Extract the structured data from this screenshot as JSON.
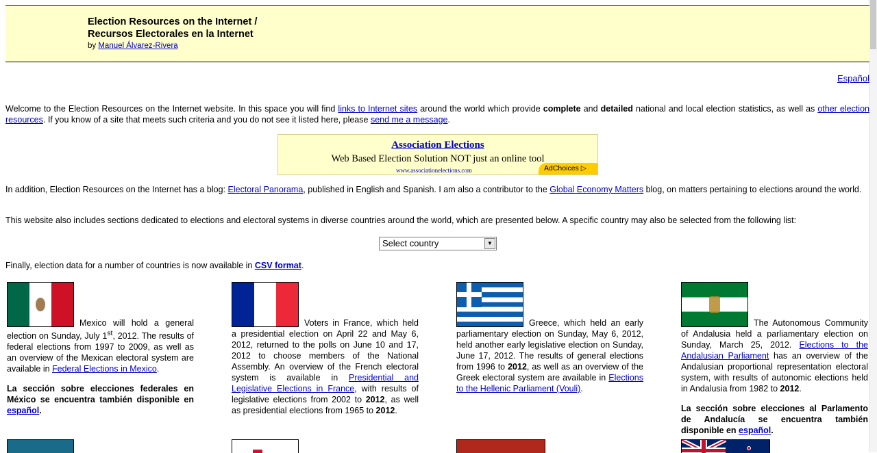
{
  "header": {
    "title_line1": "Election Resources on the Internet /",
    "title_line2": "Recursos Electorales en la Internet",
    "by_prefix": "by ",
    "author": "Manuel Álvarez-Rivera"
  },
  "language_link": "Español",
  "intro": {
    "t1": "Welcome to the Election Resources on the Internet website. In this space you will find ",
    "link1": "links to Internet sites",
    "t2": " around the world which provide ",
    "b1": "complete",
    "t3": " and ",
    "b2": "detailed",
    "t4": " national and local election statistics, as well as ",
    "link2": "other election resources",
    "t5": ". If you know of a site that meets such criteria and you do not see it listed here, please ",
    "link3": "send me a message",
    "t6": "."
  },
  "ad": {
    "title": "Association Elections",
    "text": "Web Based Election Solution NOT just an online tool",
    "url": "www.associationelections.com",
    "adchoices": "AdChoices"
  },
  "blog": {
    "t1": "In addition, Election Resources on the Internet has a blog: ",
    "link1": "Electoral Panorama",
    "t2": ", published in English and Spanish. I am also a contributor to the ",
    "link2": "Global Economy Matters",
    "t3": " blog, on matters pertaining to elections around the world."
  },
  "sections_text": "This website also includes sections dedicated to elections and electoral systems in diverse countries around the world, which are presented below. A specific country may also be selected from the following list:",
  "country_select": {
    "value": "Select country"
  },
  "csv": {
    "t1": "Finally, election data for a number of countries is now available in ",
    "link": "CSV format",
    "t2": "."
  },
  "mexico": {
    "t1": "Mexico will hold a general election on Sunday, July 1",
    "sup": "st",
    "t2": ", 2012. The results of federal elections from 1997 to 2009, as well as an overview of the Mexican electoral system are available in ",
    "link": "Federal Elections in Mexico",
    "t3": ".",
    "note": "La sección sobre elecciones federales en México se encuentra también disponible en ",
    "note_link": "español",
    "note_end": "."
  },
  "france": {
    "t1": "Voters in France, which held a presidential election on April 22 and May 6, 2012, returned to the polls on June 10 and 17, 2012 to choose members of the National Assembly. An overview of the French electoral system is available in ",
    "link": "Presidential and Legislative Elections in France",
    "t2": ", with results of legislative elections from 2002 to ",
    "b1": "2012",
    "t3": ", as well as presidential elections from 1965 to ",
    "b2": "2012",
    "t4": "."
  },
  "greece": {
    "t1": "Greece, which held an early parliamentary election on Sunday, May 6, 2012, held another early legislative election on Sunday, June 17, 2012. The results of general elections from 1996 to ",
    "b1": "2012",
    "t2": ", as well as an overview of the Greek electoral system are available in ",
    "link": "Elections to the Hellenic Parliament (Vouli)",
    "t3": "."
  },
  "andalusia": {
    "t1": "The Autonomous Community of Andalusia held a parliamentary election on Sunday, March 25, 2012. ",
    "link": "Elections to the Andalusian Parliament",
    "t2": " has an overview of the Andalusian proportional representation electoral system, with results of autonomic elections held in Andalusia from 1982 to ",
    "b1": "2012",
    "t3": ".",
    "note": "La sección sobre elecciones al Parlamento de Andalucía se encuentra también disponible en ",
    "note_link": "español",
    "note_end": "."
  },
  "colors": {
    "header_bg": "#ffffcc",
    "link": "#0000cc",
    "ad_bg": "#ffffcc",
    "adchoices": "#ffcc00"
  }
}
